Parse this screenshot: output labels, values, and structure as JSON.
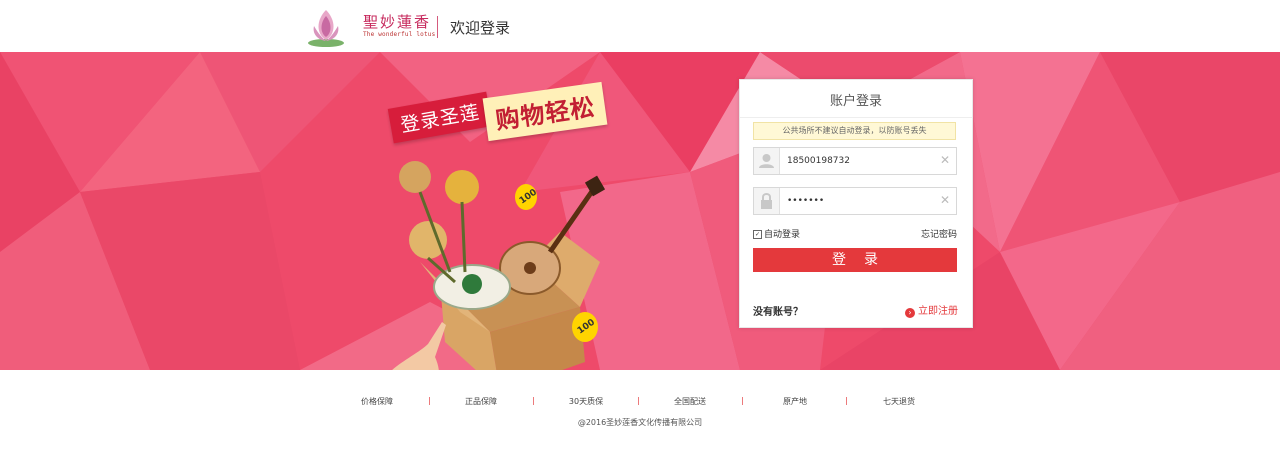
{
  "header": {
    "logo_text": "聖妙蓮香",
    "logo_subtext": "The wonderful lotus",
    "title": "欢迎登录"
  },
  "promo": {
    "ribbon_left": "登录圣莲",
    "ribbon_right": "购物轻松",
    "coupon_label": "100"
  },
  "login": {
    "title": "账户登录",
    "notice": "公共场所不建议自动登录，以防账号丢失",
    "username_value": "18500198732",
    "password_value": "•••••••",
    "clear_glyph": "✕",
    "auto_login_label": "自动登录",
    "auto_login_checked": true,
    "forgot_label": "忘记密码",
    "submit_label": "登录",
    "no_account_label": "没有账号？",
    "register_label": "立即注册",
    "accent_color": "#e4393c"
  },
  "footer": {
    "links": [
      "价格保障",
      "正品保障",
      "30天质保",
      "全国配送",
      "原产地",
      "七天退货"
    ],
    "copyright": "@2016圣妙莲香文化传播有限公司"
  }
}
